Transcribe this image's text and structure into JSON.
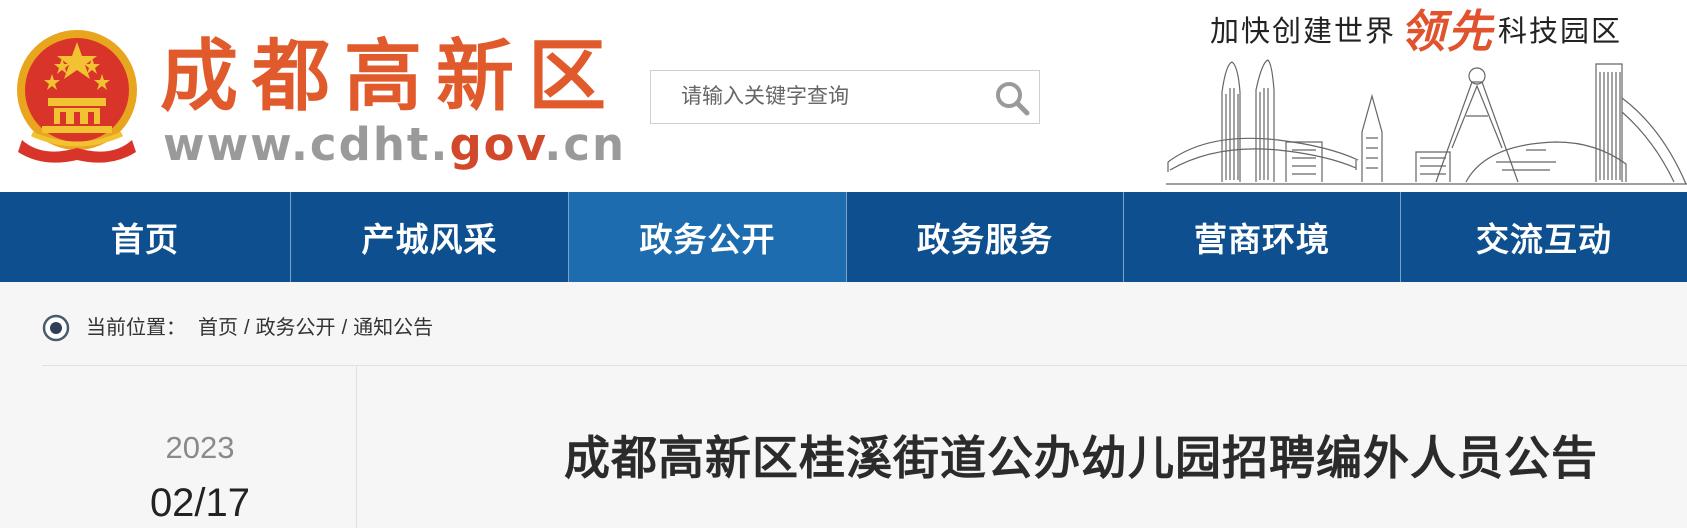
{
  "header": {
    "site_name": "成都高新区",
    "site_url_prefix": "www.cdht.",
    "site_url_accent": "gov",
    "site_url_suffix": ".cn",
    "search": {
      "placeholder": "请输入关键字查询"
    },
    "slogan": {
      "before": "加快创建世界",
      "highlight": "领先",
      "after": "科技园区"
    },
    "emblem_icon": "national-emblem-icon",
    "search_icon": "search-icon",
    "skyline_image": "city-skyline-illustration"
  },
  "nav": {
    "items": [
      {
        "label": "首页"
      },
      {
        "label": "产城风采"
      },
      {
        "label": "政务公开"
      },
      {
        "label": "政务服务"
      },
      {
        "label": "营商环境"
      },
      {
        "label": "交流互动"
      }
    ],
    "active_index": 2
  },
  "breadcrumb": {
    "label": "当前位置：",
    "items": [
      "首页",
      "政务公开",
      "通知公告"
    ],
    "separator": "/"
  },
  "article": {
    "year": "2023",
    "date": "02/17",
    "title": "成都高新区桂溪街道公办幼儿园招聘编外人员公告"
  },
  "colors": {
    "nav_bg": "#0e508f",
    "nav_active": "#1e6cb0",
    "brand_orange": "#e05a2b",
    "url_gray": "#9a9a9a",
    "content_bg": "#f6f6f6"
  }
}
